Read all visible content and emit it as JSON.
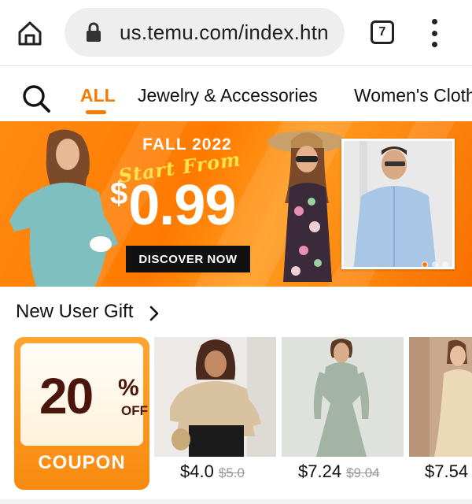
{
  "browser": {
    "url": "us.temu.com/index.htn",
    "tab_count": "7",
    "icons": {
      "home": "home-icon",
      "lock": "lock-icon",
      "tabs": "tabs-icon",
      "menu": "more-vert-icon"
    }
  },
  "category_nav": {
    "search_icon": "search-icon",
    "items": [
      {
        "label": "ALL",
        "active": true
      },
      {
        "label": "Jewelry & Accessories",
        "active": false
      },
      {
        "label": "Women's Cloth",
        "active": false
      }
    ],
    "accent_color": "#f57c00"
  },
  "banner": {
    "headline": "FALL 2022",
    "tagline": "Start From",
    "price": "$0.99",
    "price_symbol": "$",
    "price_value": "0.99",
    "cta": "DISCOVER NOW",
    "slide_count": 3,
    "active_slide": 1,
    "background_color": "#ff7a00"
  },
  "new_user_gift": {
    "title": "New User Gift",
    "coupon": {
      "value": "20",
      "symbol": "%",
      "off": "OFF",
      "label": "COUPON"
    },
    "products": [
      {
        "price": "$4.0",
        "old_price": "$5.0"
      },
      {
        "price": "$7.24",
        "old_price": "$9.04"
      },
      {
        "price": "$7.54",
        "old_price": ""
      }
    ]
  }
}
